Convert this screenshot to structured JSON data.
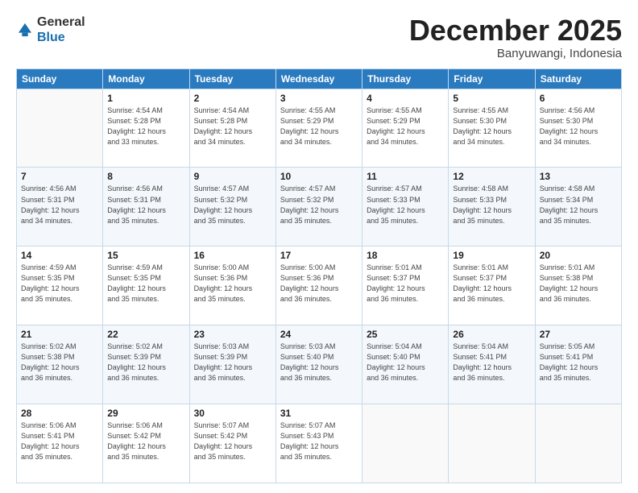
{
  "header": {
    "logo_general": "General",
    "logo_blue": "Blue",
    "month": "December 2025",
    "location": "Banyuwangi, Indonesia"
  },
  "days_of_week": [
    "Sunday",
    "Monday",
    "Tuesday",
    "Wednesday",
    "Thursday",
    "Friday",
    "Saturday"
  ],
  "weeks": [
    [
      {
        "day": "",
        "info": ""
      },
      {
        "day": "1",
        "info": "Sunrise: 4:54 AM\nSunset: 5:28 PM\nDaylight: 12 hours\nand 33 minutes."
      },
      {
        "day": "2",
        "info": "Sunrise: 4:54 AM\nSunset: 5:28 PM\nDaylight: 12 hours\nand 34 minutes."
      },
      {
        "day": "3",
        "info": "Sunrise: 4:55 AM\nSunset: 5:29 PM\nDaylight: 12 hours\nand 34 minutes."
      },
      {
        "day": "4",
        "info": "Sunrise: 4:55 AM\nSunset: 5:29 PM\nDaylight: 12 hours\nand 34 minutes."
      },
      {
        "day": "5",
        "info": "Sunrise: 4:55 AM\nSunset: 5:30 PM\nDaylight: 12 hours\nand 34 minutes."
      },
      {
        "day": "6",
        "info": "Sunrise: 4:56 AM\nSunset: 5:30 PM\nDaylight: 12 hours\nand 34 minutes."
      }
    ],
    [
      {
        "day": "7",
        "info": "Sunrise: 4:56 AM\nSunset: 5:31 PM\nDaylight: 12 hours\nand 34 minutes."
      },
      {
        "day": "8",
        "info": "Sunrise: 4:56 AM\nSunset: 5:31 PM\nDaylight: 12 hours\nand 35 minutes."
      },
      {
        "day": "9",
        "info": "Sunrise: 4:57 AM\nSunset: 5:32 PM\nDaylight: 12 hours\nand 35 minutes."
      },
      {
        "day": "10",
        "info": "Sunrise: 4:57 AM\nSunset: 5:32 PM\nDaylight: 12 hours\nand 35 minutes."
      },
      {
        "day": "11",
        "info": "Sunrise: 4:57 AM\nSunset: 5:33 PM\nDaylight: 12 hours\nand 35 minutes."
      },
      {
        "day": "12",
        "info": "Sunrise: 4:58 AM\nSunset: 5:33 PM\nDaylight: 12 hours\nand 35 minutes."
      },
      {
        "day": "13",
        "info": "Sunrise: 4:58 AM\nSunset: 5:34 PM\nDaylight: 12 hours\nand 35 minutes."
      }
    ],
    [
      {
        "day": "14",
        "info": "Sunrise: 4:59 AM\nSunset: 5:35 PM\nDaylight: 12 hours\nand 35 minutes."
      },
      {
        "day": "15",
        "info": "Sunrise: 4:59 AM\nSunset: 5:35 PM\nDaylight: 12 hours\nand 35 minutes."
      },
      {
        "day": "16",
        "info": "Sunrise: 5:00 AM\nSunset: 5:36 PM\nDaylight: 12 hours\nand 35 minutes."
      },
      {
        "day": "17",
        "info": "Sunrise: 5:00 AM\nSunset: 5:36 PM\nDaylight: 12 hours\nand 36 minutes."
      },
      {
        "day": "18",
        "info": "Sunrise: 5:01 AM\nSunset: 5:37 PM\nDaylight: 12 hours\nand 36 minutes."
      },
      {
        "day": "19",
        "info": "Sunrise: 5:01 AM\nSunset: 5:37 PM\nDaylight: 12 hours\nand 36 minutes."
      },
      {
        "day": "20",
        "info": "Sunrise: 5:01 AM\nSunset: 5:38 PM\nDaylight: 12 hours\nand 36 minutes."
      }
    ],
    [
      {
        "day": "21",
        "info": "Sunrise: 5:02 AM\nSunset: 5:38 PM\nDaylight: 12 hours\nand 36 minutes."
      },
      {
        "day": "22",
        "info": "Sunrise: 5:02 AM\nSunset: 5:39 PM\nDaylight: 12 hours\nand 36 minutes."
      },
      {
        "day": "23",
        "info": "Sunrise: 5:03 AM\nSunset: 5:39 PM\nDaylight: 12 hours\nand 36 minutes."
      },
      {
        "day": "24",
        "info": "Sunrise: 5:03 AM\nSunset: 5:40 PM\nDaylight: 12 hours\nand 36 minutes."
      },
      {
        "day": "25",
        "info": "Sunrise: 5:04 AM\nSunset: 5:40 PM\nDaylight: 12 hours\nand 36 minutes."
      },
      {
        "day": "26",
        "info": "Sunrise: 5:04 AM\nSunset: 5:41 PM\nDaylight: 12 hours\nand 36 minutes."
      },
      {
        "day": "27",
        "info": "Sunrise: 5:05 AM\nSunset: 5:41 PM\nDaylight: 12 hours\nand 35 minutes."
      }
    ],
    [
      {
        "day": "28",
        "info": "Sunrise: 5:06 AM\nSunset: 5:41 PM\nDaylight: 12 hours\nand 35 minutes."
      },
      {
        "day": "29",
        "info": "Sunrise: 5:06 AM\nSunset: 5:42 PM\nDaylight: 12 hours\nand 35 minutes."
      },
      {
        "day": "30",
        "info": "Sunrise: 5:07 AM\nSunset: 5:42 PM\nDaylight: 12 hours\nand 35 minutes."
      },
      {
        "day": "31",
        "info": "Sunrise: 5:07 AM\nSunset: 5:43 PM\nDaylight: 12 hours\nand 35 minutes."
      },
      {
        "day": "",
        "info": ""
      },
      {
        "day": "",
        "info": ""
      },
      {
        "day": "",
        "info": ""
      }
    ]
  ]
}
